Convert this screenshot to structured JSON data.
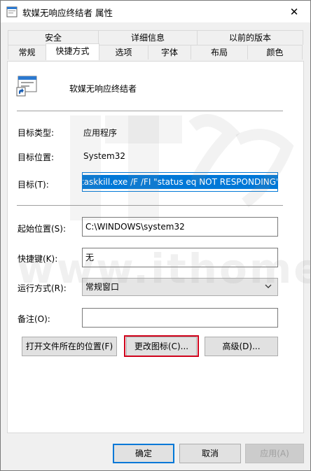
{
  "window": {
    "title": "软媒无响应终结者 属性",
    "close_glyph": "✕"
  },
  "tabs": {
    "row1": [
      "安全",
      "详细信息",
      "以前的版本"
    ],
    "row2": [
      "常规",
      "快捷方式",
      "选项",
      "字体",
      "布局",
      "颜色"
    ],
    "active": "快捷方式"
  },
  "shortcut": {
    "name": "软媒无响应终结者",
    "target_type_label": "目标类型:",
    "target_type": "应用程序",
    "target_location_label": "目标位置:",
    "target_location": "System32",
    "target_label": "目标(T):",
    "target_value": "taskkill.exe /F /FI \"status eq NOT RESPONDING\"",
    "start_in_label": "起始位置(S):",
    "start_in_value": "C:\\WINDOWS\\system32",
    "hotkey_label": "快捷键(K):",
    "hotkey_value": "无",
    "run_label": "运行方式(R):",
    "run_value": "常规窗口",
    "comment_label": "备注(O):",
    "comment_value": ""
  },
  "buttons": {
    "open_location": "打开文件所在的位置(F)",
    "change_icon": "更改图标(C)...",
    "advanced": "高级(D)...",
    "ok": "确定",
    "cancel": "取消",
    "apply": "应用(A)"
  },
  "watermark": {
    "text": "www.ithome.com"
  },
  "colors": {
    "accent": "#0078d7",
    "highlight_border": "#d0021b"
  },
  "icons": {
    "app": "shortcut-program-icon",
    "close": "close-icon",
    "dropdown": "chevron-down-icon"
  }
}
